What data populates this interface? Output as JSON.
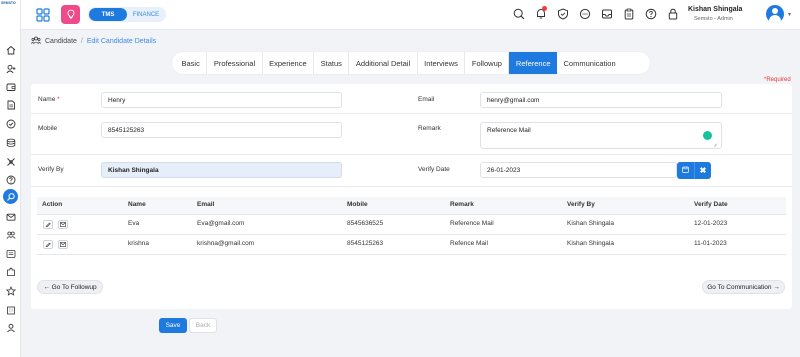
{
  "app": {
    "logo_text": "SEMSTO",
    "switch": {
      "active": "TMS",
      "other": "FINANCE"
    }
  },
  "user": {
    "name": "Kishan Shingala",
    "role": "Semsto - Admin"
  },
  "breadcrumb": {
    "main": "Candidate",
    "separator": "/",
    "sub": "Edit Candidate Details"
  },
  "tabs": [
    {
      "label": "Basic"
    },
    {
      "label": "Professional"
    },
    {
      "label": "Experience"
    },
    {
      "label": "Status"
    },
    {
      "label": "Additional Detail"
    },
    {
      "label": "Interviews"
    },
    {
      "label": "Followup"
    },
    {
      "label": "Reference",
      "active": true
    },
    {
      "label": "Communication"
    }
  ],
  "form": {
    "required_note": "*Required",
    "name_label": "Name",
    "name_required_mark": "*",
    "name_value": "Henry",
    "email_label": "Email",
    "email_value": "henry@gmail.com",
    "mobile_label": "Mobile",
    "mobile_value": "8545125263",
    "remark_label": "Remark",
    "remark_value": "Reference Mail",
    "verify_by_label": "Verify By",
    "verify_by_value": "Kishan Shingala",
    "verify_date_label": "Verify Date",
    "verify_date_value": "26-01-2023"
  },
  "table": {
    "headers": [
      "Action",
      "Name",
      "Email",
      "Mobile",
      "Remark",
      "Verify By",
      "Verify Date"
    ],
    "rows": [
      [
        "",
        "Eva",
        "Eva@gmail.com",
        "8545636525",
        "Reference Mail",
        "Kishan Shingala",
        "12-01-2023"
      ],
      [
        "",
        "krishna",
        "krishna@gmail.com",
        "8545125263",
        "Refence Mail",
        "Kishan Shingala",
        "11-01-2023"
      ]
    ]
  },
  "nav": {
    "prev_label": "← Go To Followup",
    "next_label": "Go To Communication →"
  },
  "actions": {
    "save_label": "Save",
    "back_label": "Back"
  },
  "colors": {
    "accent": "#1f7ae0",
    "bulb": "#ef4a8a",
    "required": "#e53935",
    "notification": "#f03d3d"
  },
  "icons": {
    "sidebar": [
      "home-icon",
      "user-add-icon",
      "wallet-icon",
      "document-icon",
      "shield-check-icon",
      "database-icon",
      "tools-icon",
      "help-icon",
      "search-user-icon",
      "mail-icon",
      "team-icon",
      "list-icon",
      "puzzle-icon",
      "star-icon",
      "building-icon",
      "profile-icon"
    ],
    "topbar": [
      "search-icon",
      "bell-icon",
      "shield-icon",
      "chat-icon",
      "inbox-icon",
      "clipboard-icon",
      "help-icon",
      "lock-icon"
    ]
  }
}
